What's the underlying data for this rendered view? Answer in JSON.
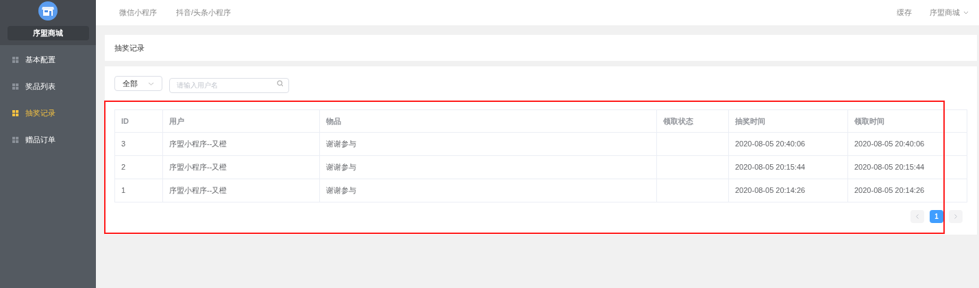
{
  "sidebar": {
    "shop_name": "序盟商城",
    "items": [
      {
        "label": "基本配置",
        "selected": false
      },
      {
        "label": "奖品列表",
        "selected": false
      },
      {
        "label": "抽奖记录",
        "selected": true
      },
      {
        "label": "赠品订单",
        "selected": false
      }
    ]
  },
  "top_tabs": [
    {
      "label": "微信小程序"
    },
    {
      "label": "抖音/头条小程序"
    }
  ],
  "top_right": {
    "cache": "缓存",
    "account": "序盟商城"
  },
  "page_title": "抽奖记录",
  "filter": {
    "select_value": "全部",
    "search_placeholder": "请输入用户名"
  },
  "table": {
    "columns": [
      "ID",
      "用户",
      "物品",
      "领取状态",
      "抽奖时间",
      "领取时间"
    ],
    "rows": [
      [
        "3",
        "序盟小程序--又橙",
        "谢谢参与",
        "",
        "2020-08-05 20:40:06",
        "2020-08-05 20:40:06"
      ],
      [
        "2",
        "序盟小程序--又橙",
        "谢谢参与",
        "",
        "2020-08-05 20:15:44",
        "2020-08-05 20:15:44"
      ],
      [
        "1",
        "序盟小程序--又橙",
        "谢谢参与",
        "",
        "2020-08-05 20:14:26",
        "2020-08-05 20:14:26"
      ]
    ]
  },
  "pagination": {
    "pages": [
      {
        "label": "1",
        "selected": true
      }
    ]
  }
}
